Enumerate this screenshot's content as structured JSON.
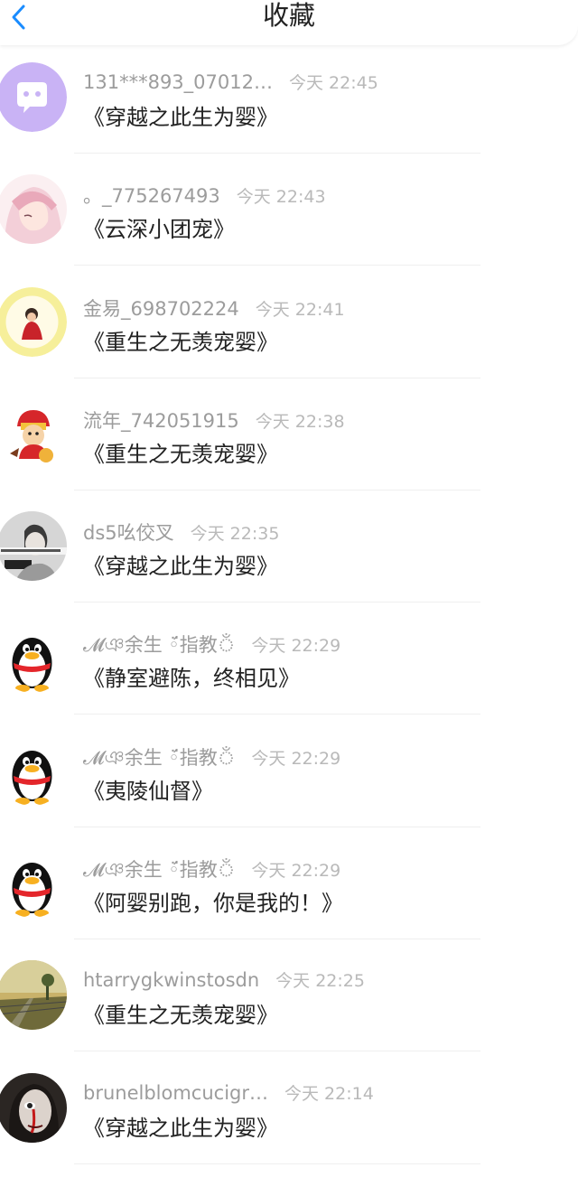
{
  "header": {
    "title": "收藏"
  },
  "items": [
    {
      "name": "131***893_07012…",
      "time": "今天 22:45",
      "book": "《穿越之此生为婴》",
      "avatar": "purple-chat-avatar"
    },
    {
      "name": "。_775267493",
      "time": "今天 22:43",
      "book": "《云深小团宠》",
      "avatar": "anime-girl-avatar"
    },
    {
      "name": "金易_698702224",
      "time": "今天 22:41",
      "book": "《重生之无羡宠婴》",
      "avatar": "figure-yellow-avatar"
    },
    {
      "name": "流年_742051915",
      "time": "今天 22:38",
      "book": "《重生之无羡宠婴》",
      "avatar": "lucky-cat-avatar"
    },
    {
      "name": "ds5吆佼叉",
      "time": "今天 22:35",
      "book": "《穿越之此生为婴》",
      "avatar": "photo-avatar"
    },
    {
      "name": "𝓜ঞ余生 ◦̈́指教ঁ",
      "time": "今天 22:29",
      "book": "《静室避陈，终相见》",
      "avatar": "penguin-avatar"
    },
    {
      "name": "𝓜ঞ余生 ◦̈́指教ঁ",
      "time": "今天 22:29",
      "book": "《夷陵仙督》",
      "avatar": "penguin-avatar"
    },
    {
      "name": "𝓜ঞ余生 ◦̈́指教ঁ",
      "time": "今天 22:29",
      "book": "《阿婴别跑，你是我的！》",
      "avatar": "penguin-avatar"
    },
    {
      "name": "htarrygkwinstosdn",
      "time": "今天 22:25",
      "book": "《重生之无羡宠婴》",
      "avatar": "railway-landscape-avatar"
    },
    {
      "name": "brunelblomcucigr…",
      "time": "今天 22:14",
      "book": "《穿越之此生为婴》",
      "avatar": "dark-face-avatar"
    }
  ],
  "colors": {
    "accent": "#1a8cff",
    "name": "#9c9c9c",
    "time": "#b9b9b9",
    "text": "#222222"
  }
}
